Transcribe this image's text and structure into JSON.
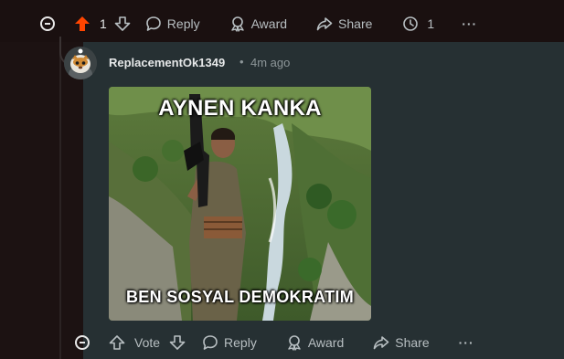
{
  "parent_actions": {
    "upvote_count": "1",
    "reply_label": "Reply",
    "award_label": "Award",
    "share_label": "Share",
    "awards_count": "1",
    "more_label": "···"
  },
  "comment": {
    "username": "ReplacementOk1349",
    "separator": "•",
    "timestamp": "4m ago",
    "meme": {
      "top_text": "AYNEN KANKA",
      "bottom_text": "BEN SOSYAL DEMOKRATIM"
    },
    "actions": {
      "vote_label": "Vote",
      "reply_label": "Reply",
      "award_label": "Award",
      "share_label": "Share",
      "more_label": "···"
    }
  },
  "colors": {
    "upvote_active": "#ff4500",
    "panel_bg": "#263033",
    "page_bg": "#1c1212"
  }
}
